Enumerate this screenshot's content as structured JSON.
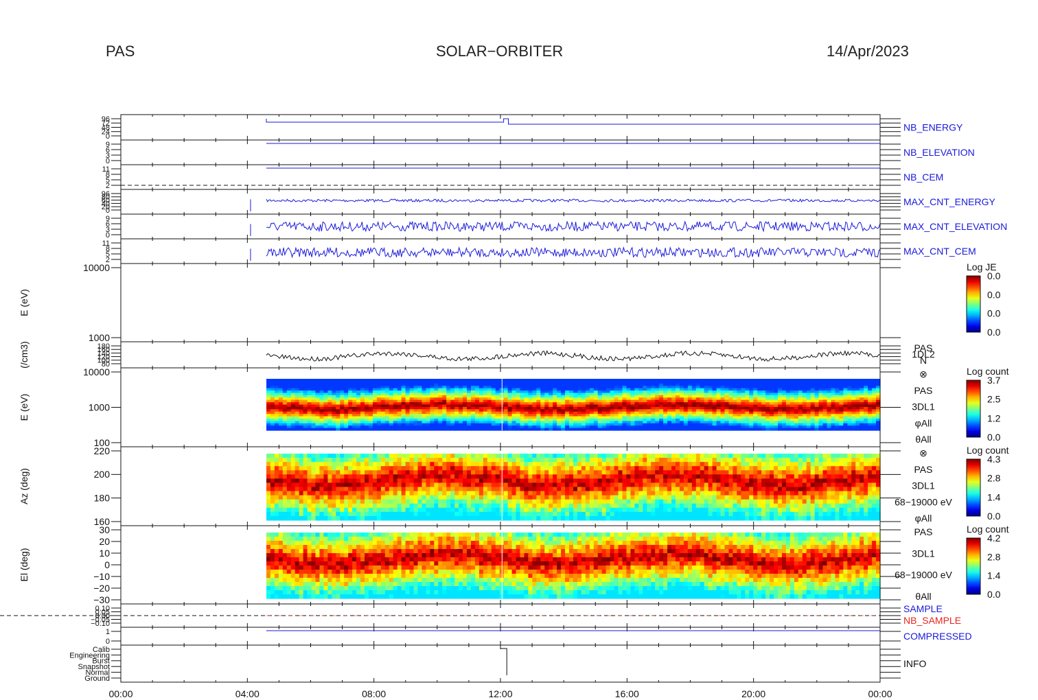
{
  "header": {
    "left": "PAS",
    "center": "SOLAR−ORBITER",
    "right": "14/Apr/2023"
  },
  "colors": {
    "blue": "#1a1adb",
    "red": "#e8251c",
    "axis": "#000000"
  },
  "chart_data": {
    "type": "heatmap",
    "x_ticks": [
      "00:00",
      "04:00",
      "08:00",
      "12:00",
      "16:00",
      "20:00",
      "00:00"
    ],
    "x_range_hours": [
      0,
      24
    ],
    "data_start_hour": 4.6,
    "panels": [
      {
        "key": "nb_energy",
        "label": "NB_ENERGY",
        "label_color": "blue",
        "kind": "step",
        "yticks": [
          "96",
          "72",
          "48",
          "24",
          "0"
        ]
      },
      {
        "key": "nb_elevation",
        "label": "NB_ELEVATION",
        "label_color": "blue",
        "kind": "flat",
        "yticks": [
          "9",
          "6",
          "3",
          "0"
        ]
      },
      {
        "key": "nb_cem",
        "label": "NB_CEM",
        "label_color": "blue",
        "kind": "flat",
        "yticks": [
          "11",
          "8",
          "5",
          "2"
        ]
      },
      {
        "key": "max_cnt_energy",
        "label": "MAX_CNT_ENERGY",
        "label_color": "blue",
        "kind": "noise",
        "yticks": [
          "96",
          "80",
          "60",
          "40",
          "20",
          "0"
        ]
      },
      {
        "key": "max_cnt_elevation",
        "label": "MAX_CNT_ELEVATION",
        "label_color": "blue",
        "kind": "noise",
        "yticks": [
          "9",
          "6",
          "3",
          "0"
        ]
      },
      {
        "key": "max_cnt_cem",
        "label": "MAX_CNT_CEM",
        "label_color": "blue",
        "kind": "noise",
        "yticks": [
          "11",
          "8",
          "5",
          "2"
        ]
      },
      {
        "key": "nb_spectrum",
        "ylabel": "E (eV)",
        "kind": "empty",
        "yticks": [
          "10000",
          "1000"
        ],
        "colorbar": {
          "title": "Log JE",
          "ticks": [
            "0.0",
            "0.0",
            "0.0",
            "0.0"
          ]
        }
      },
      {
        "key": "density",
        "ylabel": "(/cm3)",
        "kind": "line",
        "yticks": [
          "180",
          "160",
          "140",
          "120",
          "100",
          "80"
        ],
        "right_labels": [
          "PAS",
          "1DL2",
          "N"
        ]
      },
      {
        "key": "energy_spectrogram",
        "ylabel": "E (eV)",
        "kind": "spectrogram",
        "yticks": [
          "10000",
          "1000",
          "100"
        ],
        "right_labels": [
          "⊗",
          "PAS",
          "3DL1",
          "φAll",
          "θAll"
        ],
        "colorbar": {
          "title": "Log count",
          "ticks": [
            "3.7",
            "2.5",
            "1.2",
            "0.0"
          ]
        }
      },
      {
        "key": "azimuth",
        "ylabel": "Az (deg)",
        "kind": "heat",
        "yticks": [
          "220",
          "200",
          "180",
          "160"
        ],
        "right_labels": [
          "⊗",
          "PAS",
          "3DL1",
          "68−19000 eV",
          "φAll"
        ],
        "colorbar": {
          "title": "Log count",
          "ticks": [
            "4.3",
            "2.8",
            "1.4",
            "0.0"
          ]
        }
      },
      {
        "key": "elevation",
        "ylabel": "El (deg)",
        "kind": "heat",
        "yticks": [
          "30",
          "20",
          "10",
          "0",
          "−10",
          "−20",
          "−30"
        ],
        "right_labels": [
          "PAS",
          "3DL1",
          "68−19000 eV",
          "θAll"
        ],
        "colorbar": {
          "title": "Log count",
          "ticks": [
            "4.2",
            "2.8",
            "1.4",
            "0.0"
          ]
        }
      },
      {
        "key": "sample",
        "label": "SAMPLE",
        "label2": "NB_SAMPLE",
        "label_color": "blue",
        "label2_color": "red",
        "kind": "dashed",
        "yticks": [
          "0.10",
          "0.05",
          "0.00",
          "−0.05",
          "−0.10"
        ]
      },
      {
        "key": "compressed",
        "label": "COMPRESSED",
        "label_color": "blue",
        "kind": "flat",
        "yticks": [
          "1",
          "0"
        ]
      },
      {
        "key": "info",
        "label": "INFO",
        "label_color": "black",
        "kind": "info",
        "yticks": [
          "Calib",
          "Engineering",
          "Burst",
          "Snapshot",
          "Normal",
          "Ground"
        ]
      }
    ]
  }
}
